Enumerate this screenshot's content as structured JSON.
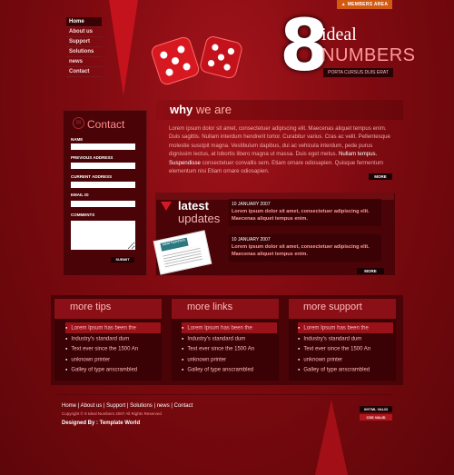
{
  "nav": {
    "items": [
      {
        "label": "Home",
        "active": true
      },
      {
        "label": "About us"
      },
      {
        "label": "Support"
      },
      {
        "label": "Solutions"
      },
      {
        "label": "news"
      },
      {
        "label": "Contact"
      }
    ]
  },
  "header": {
    "members_label": "MEMBERS AREA",
    "logo_digit": "8",
    "logo_word1": "ideal",
    "logo_word2": "NUMBERS",
    "tagline": "PORTA CURSUS DUIS ERAT"
  },
  "why": {
    "title_bold": "why",
    "title_rest": "we are",
    "text_main": "Lorem ipsum dolor sit amet, consectetuer adipiscing elit. Maecenas aliquet tempus enim. Duis sagittis. Nullam interdum hendrerit tortor. Curabitur varius. Cras ac velit. Pellentesque molestie suscipit magna. Vestibulum dapibus, dui ac vehicula interdum, pede purus dignissim lectus, at lobortis libero magna ut massa. Duis eget metus.",
    "text_highlight": "Nullam tempus. Suspendisse",
    "text_tail": "consectetuer convallis sem. Etiam ornare odiosapien. Quisque fermentum elementum nisi Etiam ornare odiosapien.",
    "more_label": "MORE"
  },
  "contact": {
    "title": "Contact",
    "fields": [
      "NAME",
      "PREVIOUS ADDRESS",
      "CURRENT ADDRESS",
      "EMAIL ID",
      "COMMENTS"
    ],
    "submit_label": "SUBMIT"
  },
  "latest": {
    "title1": "latest",
    "title2": "updates",
    "newspaper_label": "ideal Numbers",
    "items": [
      {
        "date": "10 JANUARY 2007",
        "body": "Lorem ipsum dolor sit amet, consectetuer adipiscing elit. Maecenas aliquet tempus enim."
      },
      {
        "date": "10 JANUARY 2007",
        "body": "Lorem ipsum dolor sit amet, consectetuer adipiscing elit. Maecenas aliquet tempus enim."
      }
    ],
    "more_label": "MORE"
  },
  "columns": [
    {
      "title_first": "more",
      "title_rest": "tips",
      "items": [
        "Lorem Ipsum has been the",
        "Industry's standard dum",
        "Text ever since the 1500 An",
        "unknown printer",
        "Galley of type anscrambled"
      ]
    },
    {
      "title_first": "more",
      "title_rest": "links",
      "items": [
        "Lorem Ipsum has been the",
        "Industry's standard dum",
        "Text ever since the 1500 An",
        "unknown printer",
        "Galley of type anscrambled"
      ]
    },
    {
      "title_first": "more",
      "title_rest": "support",
      "items": [
        "Lorem Ipsum has been the",
        "Industry's standard dum",
        "Text ever since the 1500 An",
        "unknown printer",
        "Galley of type anscrambled"
      ]
    }
  ],
  "footer": {
    "links": [
      "Home",
      "About us",
      "Support",
      "Solutions",
      "news",
      "Contact"
    ],
    "copyright": "Copyright © 8 Ideal Numbers 2007 All Rights Reserved",
    "designed_by": "Designed By : Template World",
    "badge1": "XHTML VALID",
    "badge2": "CSS VALID"
  }
}
